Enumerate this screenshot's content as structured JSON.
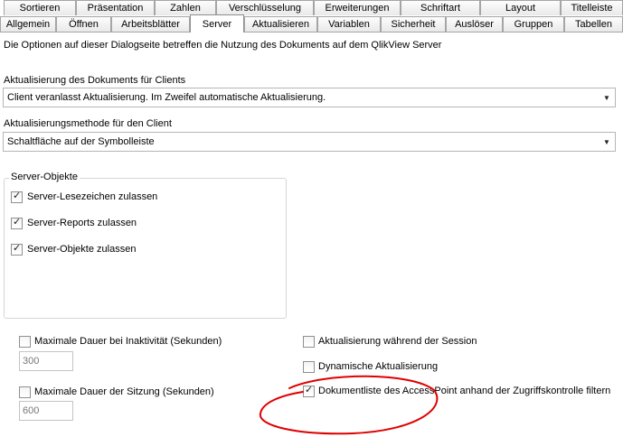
{
  "tabs_row1": [
    {
      "label": "Sortieren"
    },
    {
      "label": "Präsentation"
    },
    {
      "label": "Zahlen"
    },
    {
      "label": "Verschlüsselung"
    },
    {
      "label": "Erweiterungen"
    },
    {
      "label": "Schriftart"
    },
    {
      "label": "Layout"
    },
    {
      "label": "Titelleiste"
    }
  ],
  "tabs_row2": [
    {
      "label": "Allgemein"
    },
    {
      "label": "Öffnen"
    },
    {
      "label": "Arbeitsblätter"
    },
    {
      "label": "Server",
      "active": true
    },
    {
      "label": "Aktualisieren"
    },
    {
      "label": "Variablen"
    },
    {
      "label": "Sicherheit"
    },
    {
      "label": "Auslöser"
    },
    {
      "label": "Gruppen"
    },
    {
      "label": "Tabellen"
    }
  ],
  "description": "Die Optionen auf dieser Dialogseite betreffen die Nutzung des Dokuments auf dem QlikView Server",
  "refresh_clients": {
    "label": "Aktualisierung des Dokuments für Clients",
    "value": "Client veranlasst Aktualisierung. Im Zweifel automatische Aktualisierung."
  },
  "refresh_method": {
    "label": "Aktualisierungsmethode für den Client",
    "value": "Schaltfläche auf der Symbolleiste"
  },
  "server_objects": {
    "legend": "Server-Objekte",
    "items": [
      {
        "label": "Server-Lesezeichen zulassen",
        "checked": true
      },
      {
        "label": "Server-Reports zulassen",
        "checked": true
      },
      {
        "label": "Server-Objekte zulassen",
        "checked": true
      }
    ]
  },
  "options": {
    "max_inactivity": {
      "label": "Maximale Dauer bei Inaktivität (Sekunden)",
      "checked": false,
      "value": "300"
    },
    "max_session": {
      "label": "Maximale Dauer der Sitzung (Sekunden)",
      "checked": false,
      "value": "600"
    },
    "refresh_during_session": {
      "label": "Aktualisierung während der Session",
      "checked": false
    },
    "dynamic_refresh": {
      "label": "Dynamische Aktualisierung",
      "checked": false
    },
    "doclist_filter": {
      "label": "Dokumentliste des AccessPoint anhand der Zugriffskontrolle filtern",
      "checked": true
    }
  },
  "icons": {
    "check": "✓",
    "dropdown": "▼"
  },
  "colors": {
    "annotation": "#e00000"
  }
}
